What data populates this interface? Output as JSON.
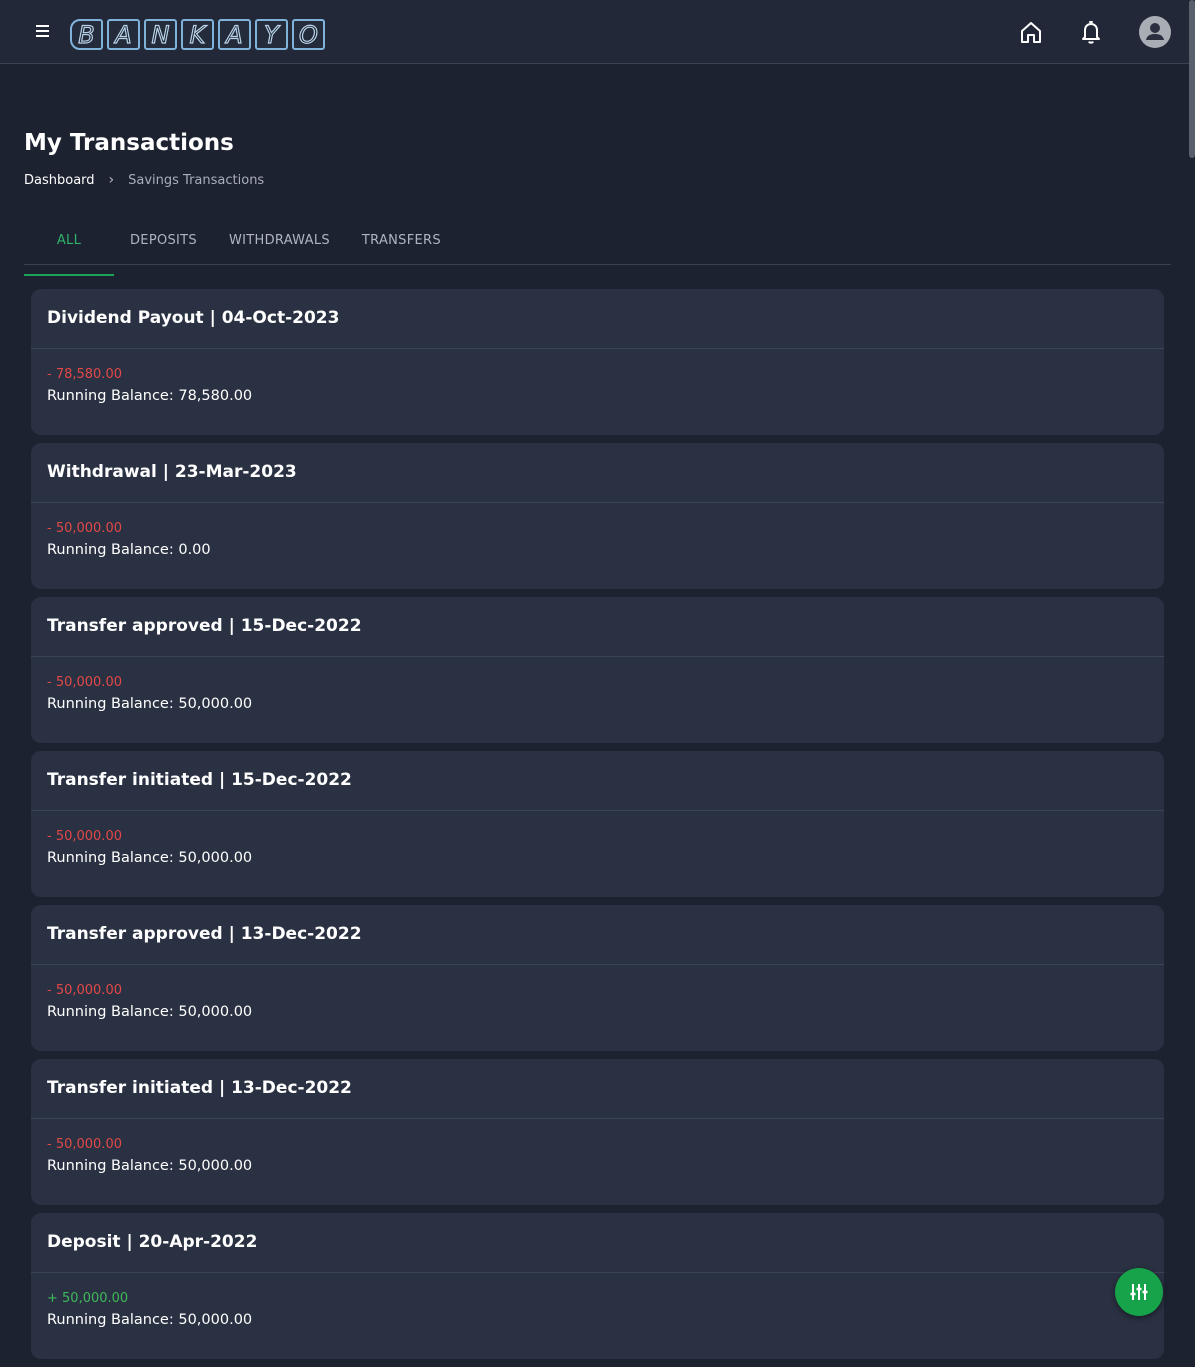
{
  "header": {
    "logo_letters": [
      "B",
      "A",
      "N",
      "K",
      "A",
      "Y",
      "O"
    ],
    "icons": [
      "menu-icon",
      "home-icon",
      "bell-icon",
      "avatar-icon"
    ]
  },
  "page": {
    "title": "My Transactions",
    "breadcrumb": {
      "home": "Dashboard",
      "separator": "›",
      "current": "Savings Transactions"
    }
  },
  "tabs": [
    {
      "label": "ALL",
      "active": true
    },
    {
      "label": "DEPOSITS",
      "active": false
    },
    {
      "label": "WITHDRAWALS",
      "active": false
    },
    {
      "label": "TRANSFERS",
      "active": false
    }
  ],
  "transactions": [
    {
      "title": "Dividend Payout | 04-Oct-2023",
      "amount": "- 78,580.00",
      "sign": "neg",
      "balance": "Running Balance: 78,580.00"
    },
    {
      "title": "Withdrawal | 23-Mar-2023",
      "amount": "- 50,000.00",
      "sign": "neg",
      "balance": "Running Balance: 0.00"
    },
    {
      "title": "Transfer approved | 15-Dec-2022",
      "amount": "- 50,000.00",
      "sign": "neg",
      "balance": "Running Balance: 50,000.00"
    },
    {
      "title": "Transfer initiated | 15-Dec-2022",
      "amount": "- 50,000.00",
      "sign": "neg",
      "balance": "Running Balance: 50,000.00"
    },
    {
      "title": "Transfer approved | 13-Dec-2022",
      "amount": "- 50,000.00",
      "sign": "neg",
      "balance": "Running Balance: 50,000.00"
    },
    {
      "title": "Transfer initiated | 13-Dec-2022",
      "amount": "- 50,000.00",
      "sign": "neg",
      "balance": "Running Balance: 50,000.00"
    },
    {
      "title": "Deposit | 20-Apr-2022",
      "amount": "+ 50,000.00",
      "sign": "pos",
      "balance": "Running Balance: 50,000.00"
    }
  ],
  "colors": {
    "background": "#1d2230",
    "card": "#2a3142",
    "accent": "#1fa35a",
    "negative": "#e34848",
    "positive": "#3fb85a"
  },
  "fab": {
    "icon": "filter-sliders-icon"
  }
}
